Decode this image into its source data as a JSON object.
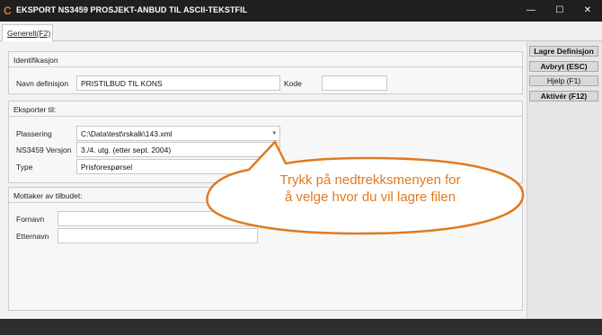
{
  "window": {
    "app_icon": "C",
    "title": "EKSPORT NS3459 PROSJEKT-ANBUD TIL ASCII-TEKSTFIL",
    "minimize": "—",
    "maximize": "☐",
    "close": "✕"
  },
  "tabs": [
    {
      "label": "Generelt(F2)",
      "active": true
    }
  ],
  "actions": {
    "save_definition": "Lagre Definisjon",
    "cancel": "Avbryt (ESC)",
    "help": "Hjelp (F1)",
    "activate": "Aktivér (F12)"
  },
  "identification": {
    "title": "Identifikasjon",
    "name_label": "Navn definisjon",
    "name_value": "PRISTILBUD TIL KONS",
    "code_label": "Kode",
    "code_value": ""
  },
  "export_to": {
    "title": "Eksporter til:",
    "location_label": "Plassering",
    "location_value": "C:\\Data\\test\\rskalk\\143.xml",
    "version_label": "NS3459 Versjon",
    "version_value": "3./4. utg. (etter sept. 2004)",
    "type_label": "Type",
    "type_value": "Prisforespørsel",
    "dropdown_arrow": "▾"
  },
  "recipient": {
    "title": "Mottaker av tilbudet:",
    "first_name_label": "Fornavn",
    "first_name_value": "",
    "last_name_label": "Etternavn",
    "last_name_value": ""
  },
  "callout": {
    "line1": "Trykk på nedtrekksmenyen for",
    "line2": "å velge hvor du vil lagre filen",
    "color": "#e07a1e"
  },
  "colors": {
    "titlebar": "#1f1f1f",
    "accent_icon": "#e8732a",
    "footer": "#2e2e2e"
  }
}
